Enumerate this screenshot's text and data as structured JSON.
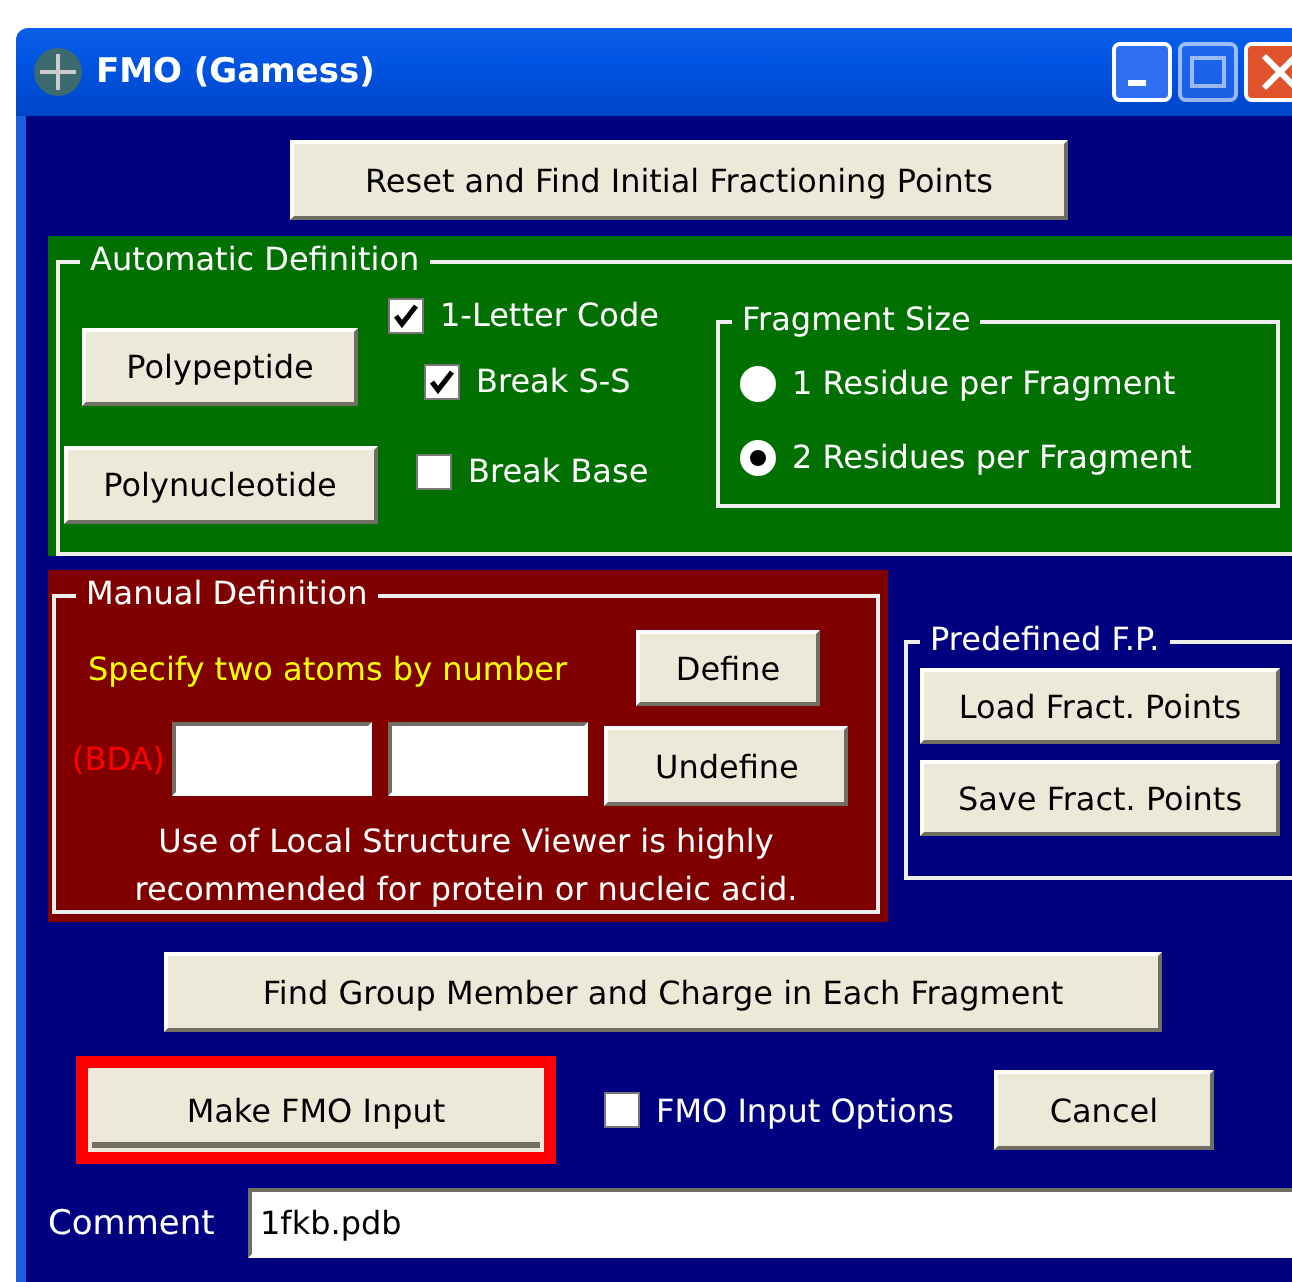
{
  "window": {
    "title": "FMO (Gamess)"
  },
  "reset_button": "Reset and Find Initial Fractioning Points",
  "automatic_definition": {
    "title": "Automatic Definition",
    "buttons": [
      "Polypeptide",
      "Polynucleotide"
    ],
    "options": [
      {
        "label": "1-Letter Code",
        "checked": true
      },
      {
        "label": "Break S-S",
        "checked": true
      },
      {
        "label": "Break Base",
        "checked": false
      }
    ],
    "fragment_size": {
      "title": "Fragment Size",
      "choices": [
        {
          "label": "1 Residue per Fragment",
          "selected": false
        },
        {
          "label": "2 Residues per Fragment",
          "selected": true
        }
      ]
    }
  },
  "manual_definition": {
    "title": "Manual Definition",
    "instruction": "Specify two atoms by number",
    "bda_label": "(BDA)",
    "define_button": "Define",
    "undefine_button": "Undefine",
    "note": "Use of Local Structure Viewer is highly recommended for protein or nucleic acid."
  },
  "predefined": {
    "title": "Predefined F.P.",
    "buttons": [
      "Load Fract. Points",
      "Save Fract. Points"
    ]
  },
  "find_group_button": "Find Group Member and Charge in Each Fragment",
  "make_input_button": {
    "label": "Make FMO Input",
    "highlighted": true
  },
  "input_options": {
    "label": "FMO Input Options",
    "checked": false
  },
  "cancel_button": "Cancel",
  "comment": {
    "label": "Comment",
    "value": "1fkb.pdb"
  }
}
